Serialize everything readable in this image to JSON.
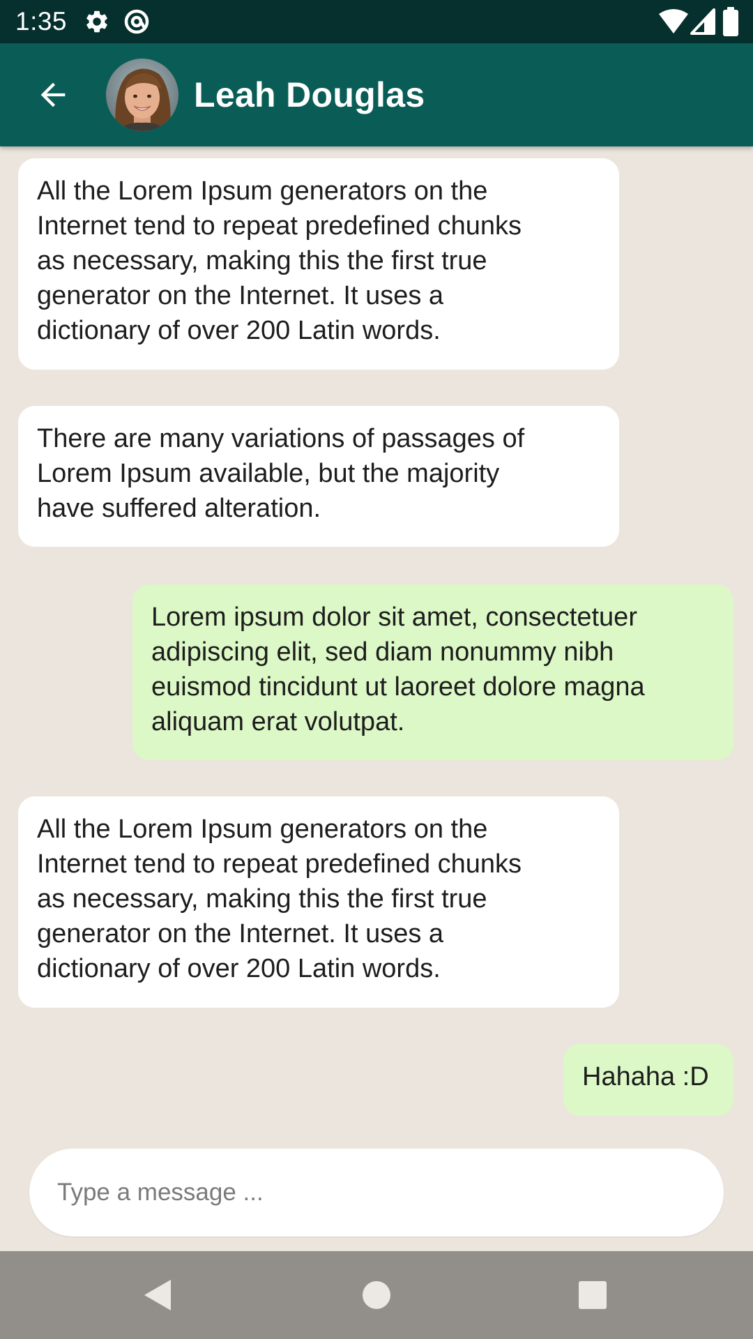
{
  "status_bar": {
    "time": "1:35",
    "icons": [
      "gear-icon",
      "at-sign-icon",
      "wifi-icon",
      "cell-signal-icon",
      "battery-icon"
    ]
  },
  "header": {
    "back_icon": "arrow-left-icon",
    "contact_name": "Leah Douglas"
  },
  "messages": [
    {
      "direction": "incoming",
      "text": "All the Lorem Ipsum generators on the\nInternet tend to repeat predefined chunks\nas necessary, making this the first true\ngenerator on the Internet. It uses a\ndictionary of over 200 Latin words."
    },
    {
      "direction": "incoming",
      "text": "There are many variations of passages of\nLorem Ipsum available, but the majority\nhave suffered alteration."
    },
    {
      "direction": "outgoing",
      "text": "Lorem ipsum dolor sit amet, consectetuer\nadipiscing elit, sed diam nonummy nibh\neuismod tincidunt ut laoreet dolore magna\naliquam erat volutpat."
    },
    {
      "direction": "incoming",
      "text": "All the Lorem Ipsum generators on the\nInternet tend to repeat predefined chunks\nas necessary, making this the first true\ngenerator on the Internet. It uses a\ndictionary of over 200 Latin words."
    },
    {
      "direction": "outgoing",
      "text": "Hahaha :D"
    }
  ],
  "composer": {
    "placeholder": "Type a message ...",
    "value": ""
  },
  "nav_bar": {
    "icons": [
      "nav-back-icon",
      "nav-home-icon",
      "nav-recents-icon"
    ]
  },
  "colors": {
    "status_bar": "#05302D",
    "app_bar": "#0A5D56",
    "chat_background": "#ECE5DD",
    "incoming_bubble": "#FFFFFF",
    "outgoing_bubble": "#DCF8C6",
    "nav_bar": "#928E89"
  }
}
